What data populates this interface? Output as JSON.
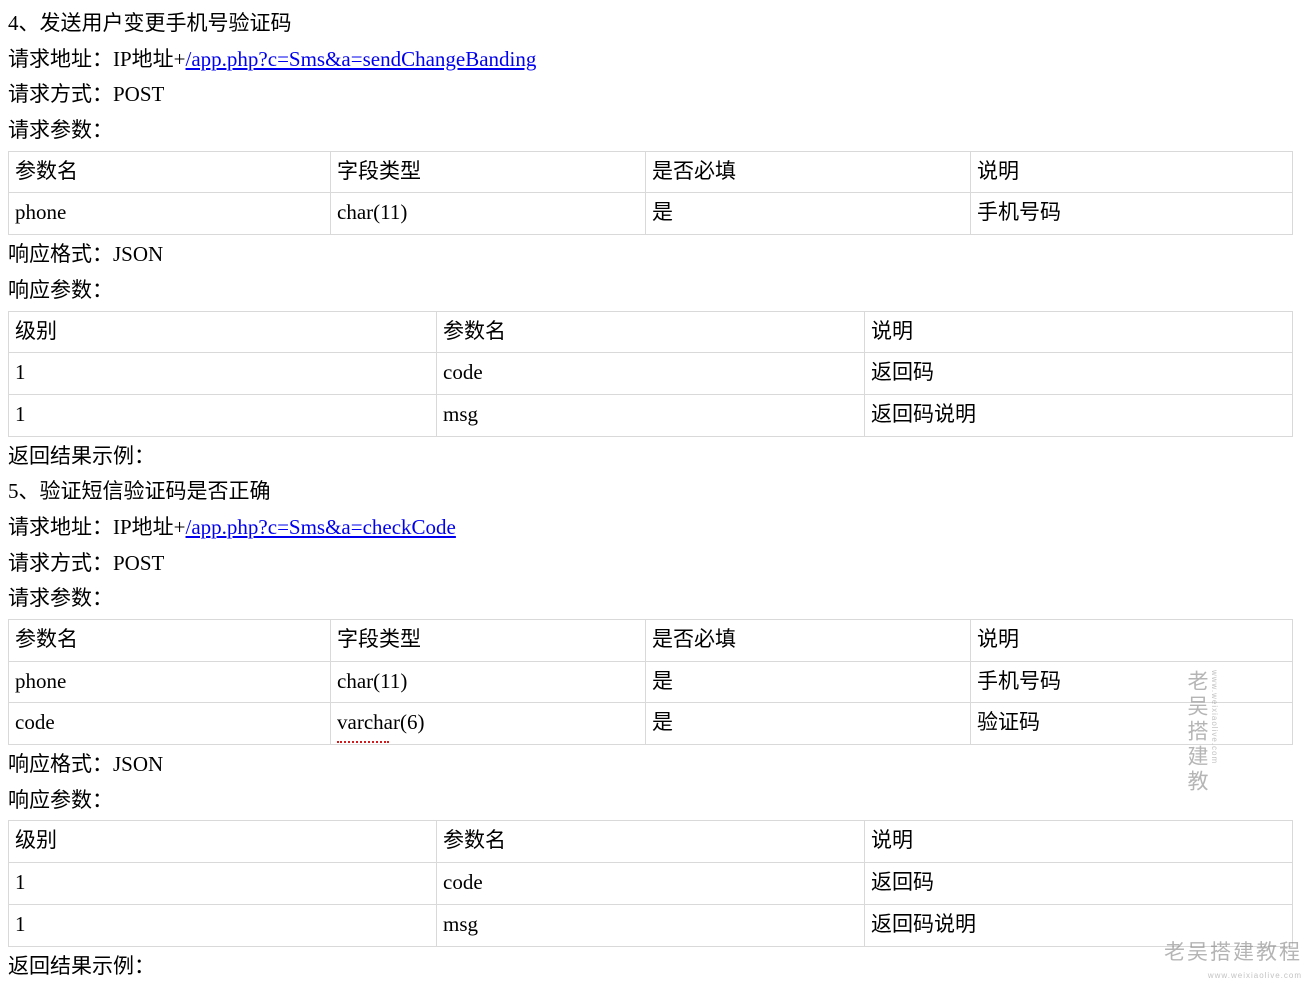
{
  "section4": {
    "title": "4、发送用户变更手机号验证码",
    "request_url_label": "请求地址：",
    "request_url_prefix": "IP地址+",
    "request_url_link": "/app.php?c=Sms&a=sendChangeBanding",
    "request_method_label": "请求方式：",
    "request_method_value": "POST",
    "request_params_label": "请求参数：",
    "request_params_header": [
      "参数名",
      "字段类型",
      "是否必填",
      "说明"
    ],
    "request_params_rows": [
      [
        "phone",
        "char(11)",
        "是",
        "手机号码"
      ]
    ],
    "response_format_label": "响应格式：",
    "response_format_value": "JSON",
    "response_params_label": "响应参数：",
    "response_params_header": [
      "级别",
      "参数名",
      "说明"
    ],
    "response_params_rows": [
      [
        "1",
        "code",
        "返回码"
      ],
      [
        "1",
        "msg",
        "返回码说明"
      ]
    ],
    "return_example_label": "返回结果示例："
  },
  "section5": {
    "title": "5、验证短信验证码是否正确",
    "request_url_label": "请求地址：",
    "request_url_prefix": "IP地址+",
    "request_url_link": "/app.php?c=Sms&a=checkCode",
    "request_method_label": "请求方式：",
    "request_method_value": "POST",
    "request_params_label": "请求参数：",
    "request_params_header": [
      "参数名",
      "字段类型",
      "是否必填",
      "说明"
    ],
    "request_params_rows": [
      [
        "phone",
        "char(11)",
        "是",
        "手机号码"
      ],
      [
        "code",
        "varchar(6)",
        "是",
        "验证码"
      ]
    ],
    "response_format_label": "响应格式：",
    "response_format_value": "JSON",
    "response_params_label": "响应参数：",
    "response_params_header": [
      "级别",
      "参数名",
      "说明"
    ],
    "response_params_rows": [
      [
        "1",
        "code",
        "返回码"
      ],
      [
        "1",
        "msg",
        "返回码说明"
      ]
    ],
    "return_example_label": "返回结果示例："
  },
  "watermark": {
    "brand_vertical": "老吴搭建教",
    "brand_horizontal": "老吴搭建教程",
    "url": "www.weixiaolive.com"
  }
}
